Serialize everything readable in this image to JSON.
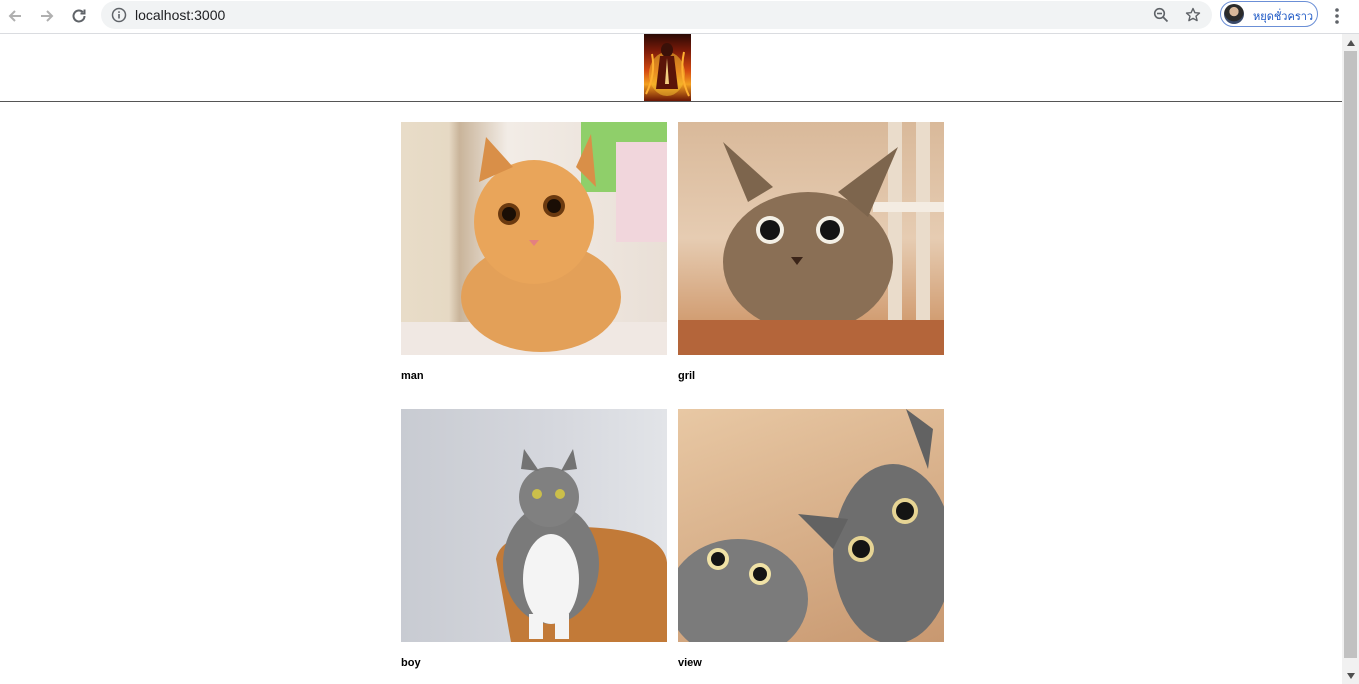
{
  "browser": {
    "url": "localhost:3000",
    "profile_name": "หยุดชั่วคราว",
    "icons": [
      "back-arrow-icon",
      "forward-arrow-icon",
      "reload-icon",
      "info-icon",
      "zoom-out-icon",
      "star-icon",
      "avatar",
      "more-vert-icon"
    ]
  },
  "colors": {
    "page_bg": "#ffffff",
    "divider": "#555555",
    "profile_accent": "#1a56c4"
  },
  "gallery": {
    "items": [
      {
        "caption": "man"
      },
      {
        "caption": "gril"
      },
      {
        "caption": "boy"
      },
      {
        "caption": "view"
      }
    ]
  }
}
